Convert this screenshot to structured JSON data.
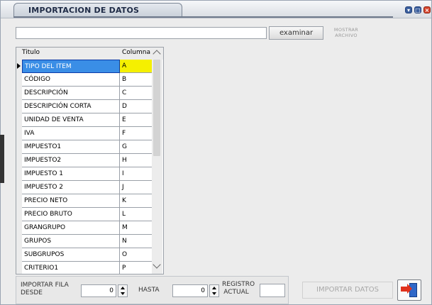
{
  "window": {
    "title": "IMPORTACION DE DATOS",
    "controls": {
      "min_icon": "minimize-icon",
      "max_icon": "maximize-icon",
      "close_icon": "close-icon"
    }
  },
  "file": {
    "path_value": "",
    "examinar_label": "examinar",
    "mostrar_line1": "MOSTRAR",
    "mostrar_line2": "ARCHIVO"
  },
  "grid": {
    "headers": {
      "titulo": "Titulo",
      "columna": "Columna"
    },
    "selected_row_index": 0,
    "rows": [
      {
        "titulo": "TIPO DEL ITEM",
        "columna": "A"
      },
      {
        "titulo": "CÓDIGO",
        "columna": "B"
      },
      {
        "titulo": "DESCRIPCIÓN",
        "columna": "C"
      },
      {
        "titulo": "DESCRIPCIÓN CORTA",
        "columna": "D"
      },
      {
        "titulo": "UNIDAD DE VENTA",
        "columna": "E"
      },
      {
        "titulo": "IVA",
        "columna": "F"
      },
      {
        "titulo": "IMPUESTO1",
        "columna": "G"
      },
      {
        "titulo": "IMPUESTO2",
        "columna": "H"
      },
      {
        "titulo": "IMPUESTO 1",
        "columna": "I"
      },
      {
        "titulo": "IMPUESTO 2",
        "columna": "J"
      },
      {
        "titulo": "PRECIO NETO",
        "columna": "K"
      },
      {
        "titulo": "PRECIO BRUTO",
        "columna": "L"
      },
      {
        "titulo": "GRANGRUPO",
        "columna": "M"
      },
      {
        "titulo": "GRUPOS",
        "columna": "N"
      },
      {
        "titulo": "SUBGRUPOS",
        "columna": "O"
      },
      {
        "titulo": "CRITERIO1",
        "columna": "P"
      }
    ]
  },
  "import": {
    "desde_label_line1": "IMPORTAR FILA",
    "desde_label_line2": "DESDE",
    "desde_value": "0",
    "hasta_label": "HASTA",
    "hasta_value": "0",
    "registro_line1": "REGISTRO",
    "registro_line2": "ACTUAL",
    "registro_value": "",
    "importar_label": "IMPORTAR DATOS",
    "exit_icon": "exit-door-icon"
  },
  "colors": {
    "selection_blue": "#3a8ee6",
    "selection_yellow": "#f5f000",
    "close_red": "#d6452d"
  }
}
